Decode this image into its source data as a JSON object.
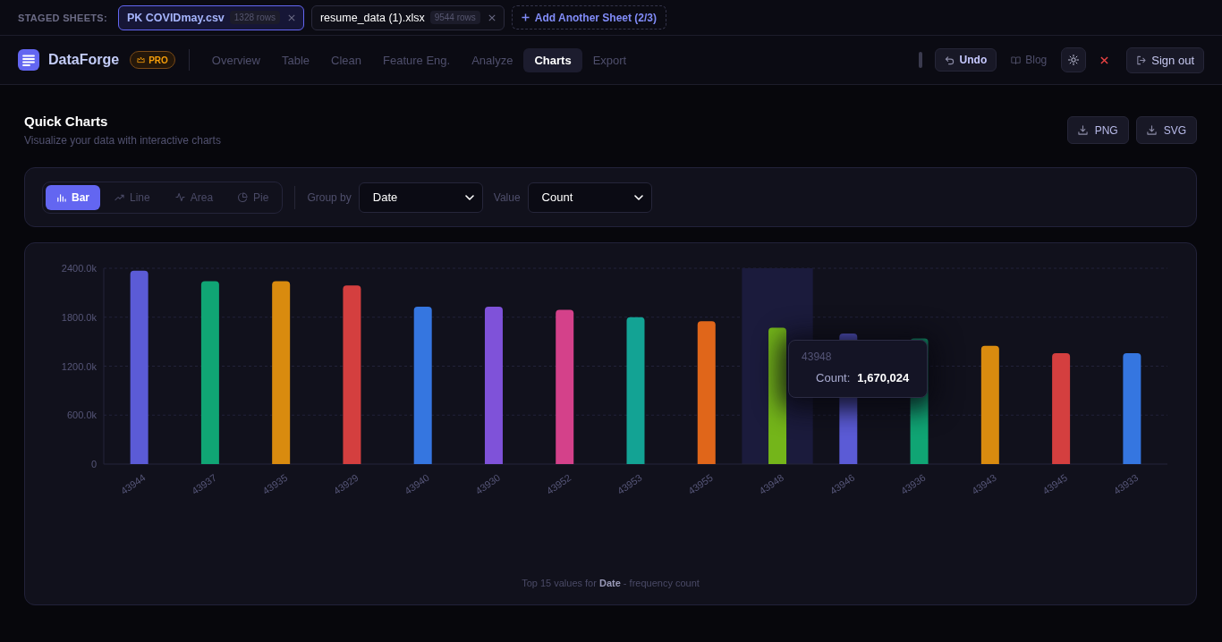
{
  "staged_sheets": {
    "label": "STAGED SHEETS:",
    "sheets": [
      {
        "name": "PK COVIDmay.csv",
        "rows": "1328 rows",
        "selected": true
      },
      {
        "name": "resume_data (1).xlsx",
        "rows": "9544 rows",
        "selected": false
      }
    ],
    "add_button": "Add Another Sheet (2/3)"
  },
  "nav": {
    "brand": "DataForge",
    "badge": "PRO",
    "tabs": [
      {
        "label": "Overview",
        "selected": false
      },
      {
        "label": "Table",
        "selected": false
      },
      {
        "label": "Clean",
        "selected": false
      },
      {
        "label": "Feature Eng.",
        "selected": false
      },
      {
        "label": "Analyze",
        "selected": false
      },
      {
        "label": "Charts",
        "selected": true
      },
      {
        "label": "Export",
        "selected": false
      }
    ],
    "actions": [
      {
        "kind": "undo",
        "label": "Undo"
      },
      {
        "kind": "link",
        "label": "Blog"
      },
      {
        "kind": "theme"
      },
      {
        "kind": "close"
      },
      {
        "kind": "signout",
        "label": "Sign out"
      }
    ]
  },
  "header": {
    "title": "Quick Charts",
    "subtitle": "Visualize your data with interactive charts",
    "exports": [
      "PNG",
      "SVG"
    ]
  },
  "controls": {
    "chart_types": [
      {
        "kind": "bar",
        "label": "Bar",
        "selected": true
      },
      {
        "kind": "line",
        "label": "Line",
        "selected": false
      },
      {
        "kind": "area",
        "label": "Area",
        "selected": false
      },
      {
        "kind": "pie",
        "label": "Pie",
        "selected": false
      }
    ],
    "group_by": {
      "label": "Group by",
      "value": "Date"
    },
    "value": {
      "label": "Value",
      "value": "Count"
    }
  },
  "chart": {
    "chart_data": {
      "type": "bar",
      "categories": [
        "43944",
        "43937",
        "43935",
        "43929",
        "43940",
        "43930",
        "43952",
        "43953",
        "43955",
        "43948",
        "43946",
        "43936",
        "43943",
        "43945",
        "43933"
      ],
      "series": [
        {
          "values": [
            2370000,
            2240000,
            2240000,
            2190000,
            1930000,
            1930000,
            1890000,
            1800000,
            1750000,
            1670024,
            1600000,
            1540000,
            1450000,
            1360000,
            1360000
          ]
        }
      ],
      "colors": [
        "#5b5bd6",
        "#10a574",
        "#d98b0f",
        "#d43f3f",
        "#3576e0",
        "#7f52d9",
        "#d4418a",
        "#13a394",
        "#e0661a",
        "#74b51a",
        "#5b5bd6",
        "#10a574",
        "#d98b0f",
        "#d43f3f",
        "#3576e0"
      ],
      "ylim": [
        0,
        2400000
      ],
      "yticks": [
        {
          "value": 0,
          "label": "0"
        },
        {
          "value": 600000,
          "label": "600.0k"
        },
        {
          "value": 1200000,
          "label": "1200.0k"
        },
        {
          "value": 1800000,
          "label": "1800.0k"
        },
        {
          "value": 2400000,
          "label": "2400.0k"
        }
      ],
      "grid": true,
      "bands": [
        {
          "axis": "x",
          "from": "43948",
          "to": "43948",
          "color": "#1b1b3c"
        }
      ]
    },
    "tooltip": {
      "title": "43948",
      "label": "Count:",
      "value": "1,670,024"
    },
    "caption": "Top 15 values for **Date** - frequency count"
  }
}
